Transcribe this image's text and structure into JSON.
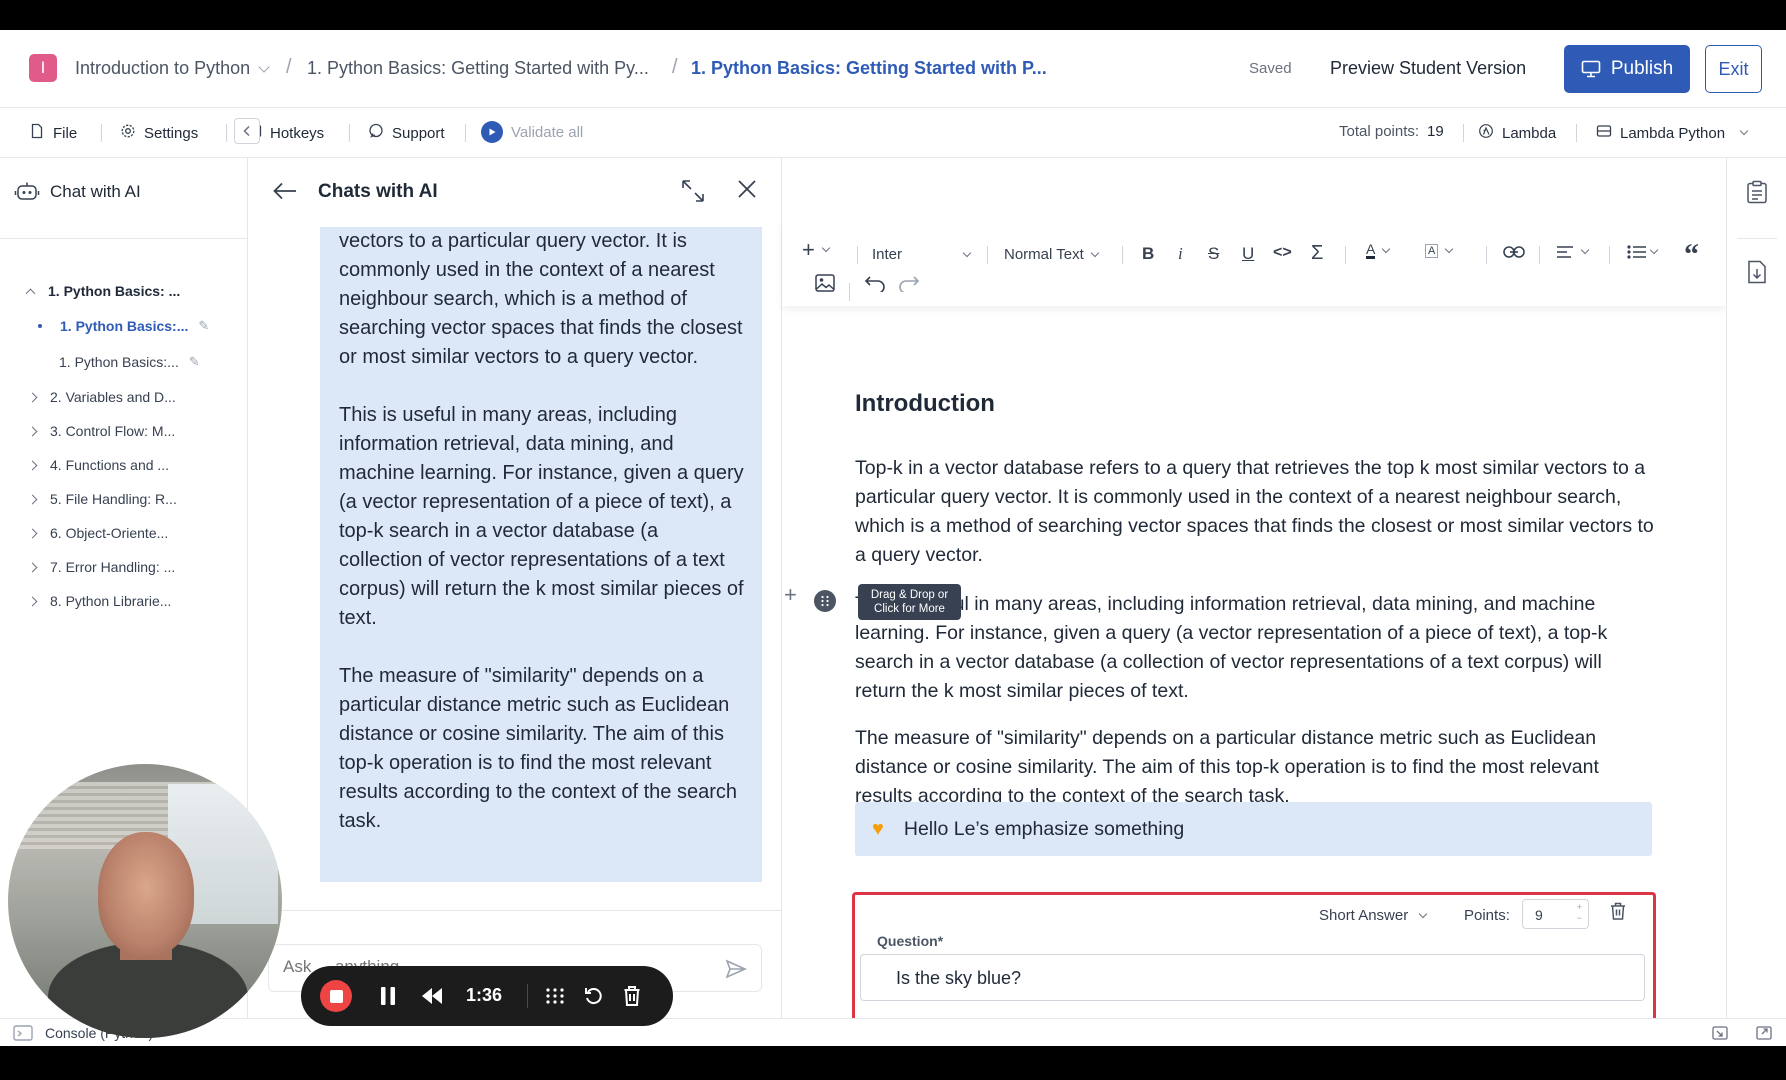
{
  "header": {
    "logo_letter": "I",
    "breadcrumbs": [
      "Introduction to Python",
      "1. Python Basics: Getting Started with Py...",
      "1. Python Basics: Getting Started with P..."
    ],
    "saved": "Saved",
    "preview": "Preview Student Version",
    "publish": "Publish",
    "exit": "Exit"
  },
  "menubar": {
    "file": "File",
    "settings": "Settings",
    "hotkeys": "Hotkeys",
    "support": "Support",
    "validate": "Validate all",
    "total_points_label": "Total points:",
    "total_points": "19",
    "lambda": "Lambda",
    "lambda_python": "Lambda Python"
  },
  "sidebar": {
    "chat_ai": "Chat with AI",
    "items": [
      "1. Python Basics: ...",
      "1. Python Basics:...",
      "1. Python Basics:...",
      "2. Variables and D...",
      "3. Control Flow: M...",
      "4. Functions and ...",
      "5. File Handling: R...",
      "6. Object-Oriente...",
      "7. Error Handling: ...",
      "8. Python Librarie..."
    ]
  },
  "chat": {
    "title": "Chats with AI",
    "paragraphs": [
      "vectors to a particular query vector. It is commonly used in the context of a nearest neighbour search, which is a method of searching vector spaces that finds the closest or most similar vectors to a query vector.",
      "This is useful in many areas, including information retrieval, data mining, and machine learning. For instance, given a query (a vector representation of a piece of text), a top-k search in a vector database (a collection of vector representations of a text corpus) will return the k most similar pieces of text.",
      "The measure of \"similarity\" depends on a particular distance metric such as Euclidean distance or cosine similarity. The aim of this top-k operation is to find the most relevant results according to the context of the search task."
    ],
    "input_placeholder": "Ask ... anything"
  },
  "editor": {
    "font": "Inter",
    "style": "Normal Text",
    "heading": "Introduction",
    "paragraphs": [
      "Top-k in a vector database refers to a query that retrieves the top k most similar vectors to a particular query vector. It is commonly used in the context of a nearest neighbour search, which is a method of searching vector spaces that finds the closest or most similar vectors to a query vector.",
      "This is useful in many areas, including information retrieval, data mining, and machine learning. For instance, given a query (a vector representation of a piece of text), a top-k search in a vector database (a collection of vector representations of a text corpus) will return the k most similar pieces of text.",
      "The measure of \"similarity\" depends on a particular distance metric such as Euclidean distance or cosine similarity. The aim of this top-k operation is to find the most relevant results according to the context of the search task."
    ],
    "tooltip_line1": "Drag & Drop or",
    "tooltip_line2": "Click for More",
    "callout": "Hello Le’s emphasize something",
    "question": {
      "type": "Short Answer",
      "points_label": "Points:",
      "points": "9",
      "label": "Question*",
      "text": "Is the sky blue?"
    }
  },
  "console": {
    "label": "Console (Python)"
  },
  "recorder": {
    "time": "1:36"
  },
  "colors": {
    "accent": "#2f5bb7",
    "callout_bg": "#dce8f8",
    "error_border": "#dc3545",
    "record": "#ef4444"
  }
}
